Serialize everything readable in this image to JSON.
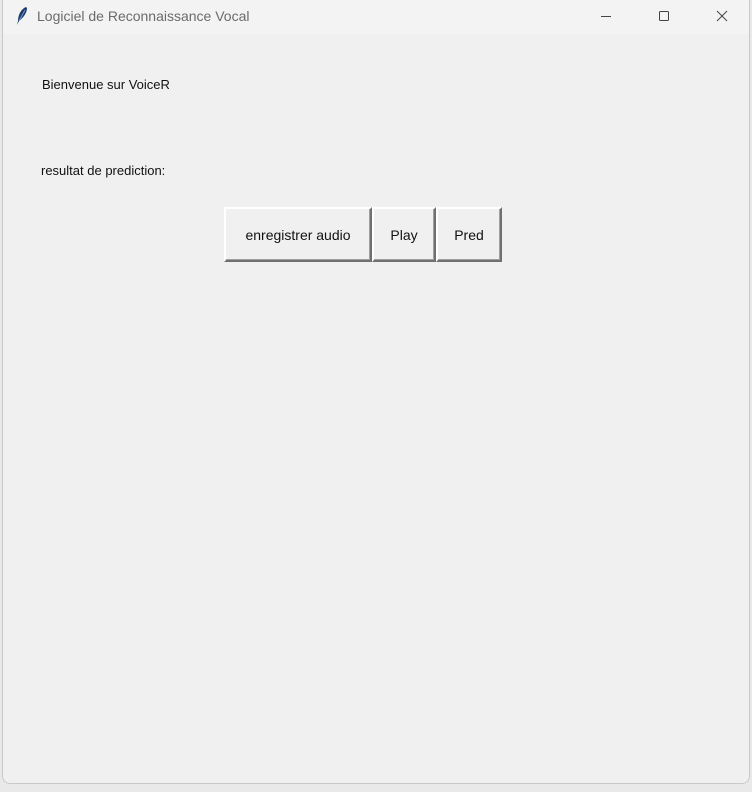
{
  "window": {
    "title": "Logiciel de Reconnaissance Vocal",
    "icon": "feather-icon"
  },
  "titlebar_controls": {
    "minimize_icon": "minimize-icon",
    "maximize_icon": "maximize-icon",
    "close_icon": "close-icon"
  },
  "main": {
    "welcome_text": "Bienvenue sur VoiceR",
    "result_label": "resultat de prediction:"
  },
  "buttons": {
    "record_label": "enregistrer audio",
    "play_label": "Play",
    "pred_label": "Pred"
  }
}
